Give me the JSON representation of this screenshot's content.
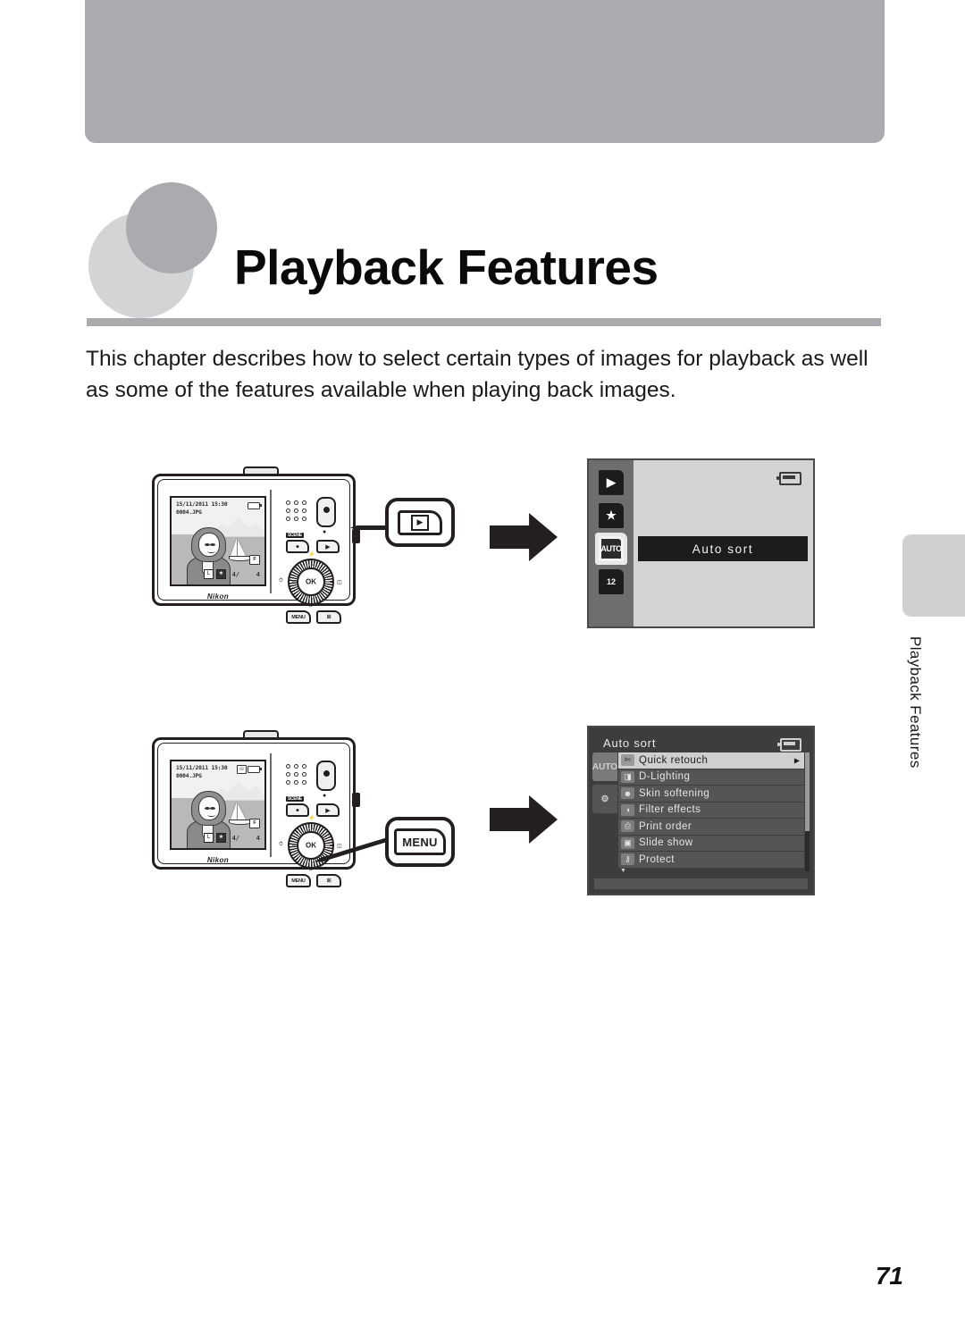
{
  "page": {
    "chapter_title": "Playback Features",
    "intro": "This chapter describes how to select certain types of images for playback as well as some of the features available when playing back images.",
    "side_tab_label": "Playback Features",
    "page_number": "71"
  },
  "figure_1": {
    "camera": {
      "lcd": {
        "datetime": "15/11/2011 15:30",
        "filename": "0004.JPG",
        "frame_current": "4/",
        "frame_total": "4",
        "quality_badge": "F",
        "badge_a": "L",
        "badge_b": "★",
        "brand": "Nikon"
      },
      "buttons": {
        "scene_tag": "SCENE",
        "record_glyph": "●",
        "playback_glyph": "▶",
        "ok_label": "OK",
        "menu_label": "MENU",
        "delete_glyph": "☒"
      }
    },
    "callout": {
      "button_name": "playback-button",
      "glyph": "▶"
    },
    "screen": {
      "sidebar_icons": [
        "▶",
        "★",
        "AUTO",
        "12"
      ],
      "selected_icon_index": 2,
      "battery_icon": "battery-icon",
      "highlight_bar_label": "Auto sort"
    }
  },
  "figure_2": {
    "camera": {
      "lcd": {
        "datetime": "15/11/2011 15:30",
        "filename": "0004.JPG",
        "frame_current": "4/",
        "frame_total": "4",
        "quality_badge": "F",
        "badge_a": "L",
        "badge_b": "★",
        "hide_icon": "☒",
        "brand": "Nikon"
      },
      "buttons": {
        "scene_tag": "SCENE",
        "record_glyph": "●",
        "playback_glyph": "▶",
        "ok_label": "OK",
        "menu_label": "MENU",
        "delete_glyph": "☒"
      }
    },
    "callout": {
      "button_name": "menu-button",
      "label": "MENU"
    },
    "screen": {
      "title": "Auto sort",
      "battery_icon": "battery-icon",
      "sidebar_tabs": [
        "AUTO",
        "⚙"
      ],
      "selected_tab_index": 0,
      "menu_items": [
        {
          "icon": "quick-retouch-icon",
          "glyph": "✄",
          "label": "Quick retouch",
          "selected": true,
          "has_submenu": true
        },
        {
          "icon": "d-lighting-icon",
          "glyph": "◨",
          "label": "D-Lighting",
          "selected": false,
          "has_submenu": false
        },
        {
          "icon": "skin-softening-icon",
          "glyph": "☻",
          "label": "Skin softening",
          "selected": false,
          "has_submenu": false
        },
        {
          "icon": "filter-effects-icon",
          "glyph": "◑",
          "label": "Filter effects",
          "selected": false,
          "has_submenu": false
        },
        {
          "icon": "print-order-icon",
          "glyph": "⎙",
          "label": "Print order",
          "selected": false,
          "has_submenu": false
        },
        {
          "icon": "slide-show-icon",
          "glyph": "▣",
          "label": "Slide show",
          "selected": false,
          "has_submenu": false
        },
        {
          "icon": "protect-icon",
          "glyph": "⚷",
          "label": "Protect",
          "selected": false,
          "has_submenu": false
        }
      ],
      "scroll_down_indicator": "▼"
    }
  },
  "colors": {
    "band_gray": "#a9abae",
    "circle_light": "#d3d4d6",
    "circle_dark": "#a9abae",
    "tab_gray": "#cfd0d2",
    "ink": "#231f20"
  }
}
